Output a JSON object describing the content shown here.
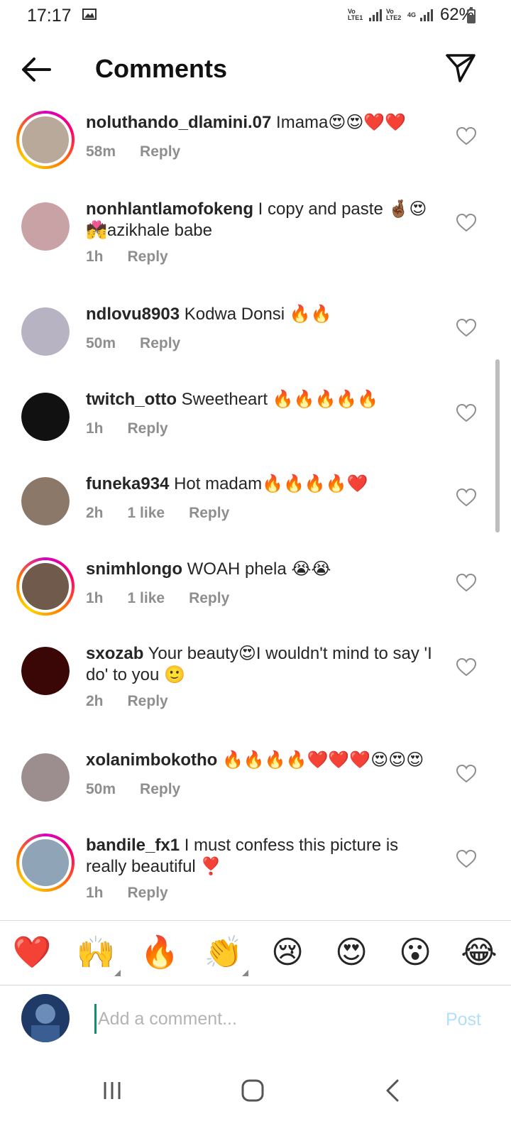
{
  "status_bar": {
    "time": "17:17",
    "sim1_label": "Vo LTE1",
    "sim2_label": "Vo LTE2",
    "network_type": "4G",
    "battery_percent": "62%",
    "battery_level": 0.62
  },
  "header": {
    "title": "Comments"
  },
  "comments": [
    {
      "username": "noluthando_dlamini.07",
      "text": " Imama😍😍❤️❤️",
      "time": "58m",
      "likes": "",
      "reply_label": "Reply",
      "avatar_color": "#b9a99a"
    },
    {
      "username": "nonhlantlamofokeng",
      "text": " I copy and paste 🤞🏾😍💏azikhale babe",
      "time": "1h",
      "likes": "",
      "reply_label": "Reply",
      "avatar_color": "#c9a2a6"
    },
    {
      "username": "ndlovu8903",
      "text": " Kodwa  Donsi 🔥🔥",
      "time": "50m",
      "likes": "",
      "reply_label": "Reply",
      "avatar_color": "#b7b3c2"
    },
    {
      "username": "twitch_otto",
      "text": " Sweetheart 🔥🔥🔥🔥🔥",
      "time": "1h",
      "likes": "",
      "reply_label": "Reply",
      "avatar_color": "#111111"
    },
    {
      "username": "funeka934",
      "text": " Hot madam🔥🔥🔥🔥❤️",
      "time": "2h",
      "likes": "1 like",
      "reply_label": "Reply",
      "avatar_color": "#8c7868"
    },
    {
      "username": "snimhlongo",
      "text": " WOAH phela 😭😭",
      "time": "1h",
      "likes": "1 like",
      "reply_label": "Reply",
      "avatar_color": "#6f5a4c"
    },
    {
      "username": "sxozab",
      "text": " Your beauty😍I wouldn't mind to say 'I do' to you 🙂",
      "time": "2h",
      "likes": "",
      "reply_label": "Reply",
      "avatar_color": "#3a0606"
    },
    {
      "username": "xolanimbokotho",
      "text": " 🔥🔥🔥🔥❤️❤️❤️😍😍😍",
      "time": "50m",
      "likes": "",
      "reply_label": "Reply",
      "avatar_color": "#9c8d8f"
    },
    {
      "username": "bandile_fx1",
      "text": " I must confess this picture is really beautiful ❣️",
      "time": "1h",
      "likes": "",
      "reply_label": "Reply",
      "avatar_color": "#8fa4b6"
    }
  ],
  "quick_reactions": [
    {
      "emoji": "❤️",
      "icon": "red-heart-emoji",
      "has_variants": false
    },
    {
      "emoji": "🙌",
      "icon": "raising-hands-emoji",
      "has_variants": true
    },
    {
      "emoji": "🔥",
      "icon": "fire-emoji",
      "has_variants": false
    },
    {
      "emoji": "👏",
      "icon": "clapping-hands-emoji",
      "has_variants": true
    },
    {
      "emoji": "😢",
      "icon": "crying-face-emoji",
      "has_variants": false
    },
    {
      "emoji": "😍",
      "icon": "heart-eyes-emoji",
      "has_variants": false
    },
    {
      "emoji": "😮",
      "icon": "surprised-face-emoji",
      "has_variants": false
    },
    {
      "emoji": "😂",
      "icon": "tears-of-joy-emoji",
      "has_variants": false
    }
  ],
  "composer": {
    "placeholder": "Add a comment...",
    "value": "",
    "post_label": "Post",
    "post_color": "#b2dffc"
  },
  "colors": {
    "story_ring": "#d300c5",
    "meta_text": "#8e8e8e",
    "heart_outline": "#8e8e8e"
  }
}
